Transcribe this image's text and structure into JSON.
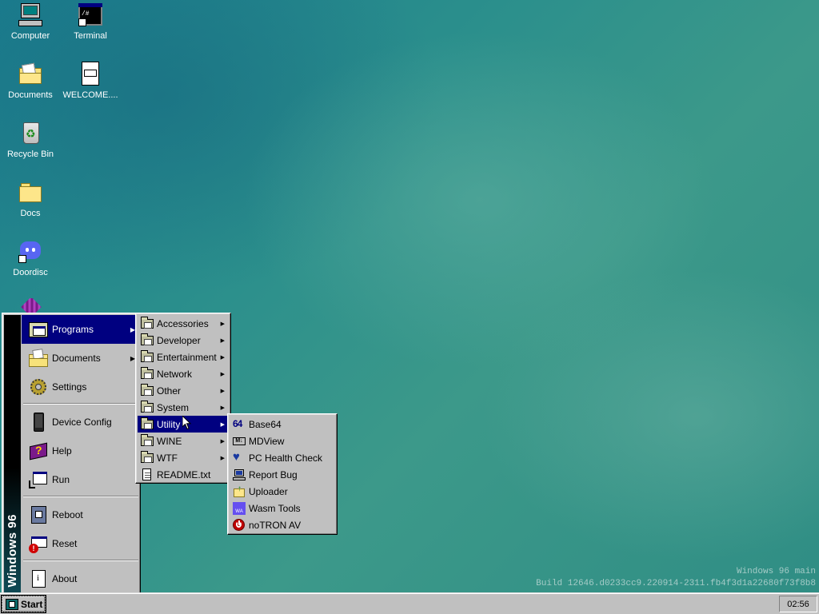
{
  "desktop": {
    "icons": [
      {
        "label": "Computer",
        "icon": "computer-icon"
      },
      {
        "label": "Terminal",
        "icon": "terminal-icon"
      },
      {
        "label": "Documents",
        "icon": "documents-folder-icon"
      },
      {
        "label": "WELCOME....",
        "icon": "markdown-file-icon"
      },
      {
        "label": "Recycle Bin",
        "icon": "recycle-bin-icon"
      },
      {
        "label": "Docs",
        "icon": "folder-icon"
      },
      {
        "label": "Doordisc",
        "icon": "doordisc-icon"
      }
    ],
    "build_line1": "Windows 96 main",
    "build_line2": "Build 12646.d0233cc9.220914-2311.fb4f3d1a22680f73f8b8"
  },
  "start_menu": {
    "banner": "Windows 96",
    "items": [
      {
        "label": "Programs",
        "icon": "programs-icon",
        "submenu": true
      },
      {
        "label": "Documents",
        "icon": "documents-icon",
        "submenu": true
      },
      {
        "label": "Settings",
        "icon": "settings-icon",
        "submenu": false
      },
      {
        "label": "Device Config",
        "icon": "device-config-icon",
        "submenu": false
      },
      {
        "label": "Help",
        "icon": "help-book-icon",
        "submenu": false
      },
      {
        "label": "Run",
        "icon": "run-icon",
        "submenu": false
      },
      {
        "label": "Reboot",
        "icon": "reboot-icon",
        "submenu": false
      },
      {
        "label": "Reset",
        "icon": "reset-icon",
        "submenu": false
      },
      {
        "label": "About",
        "icon": "about-icon",
        "submenu": false
      }
    ]
  },
  "programs_menu": {
    "items": [
      "Accessories",
      "Developer",
      "Entertainment",
      "Network",
      "Other",
      "System",
      "Utility",
      "WINE",
      "WTF",
      "README.txt"
    ]
  },
  "utility_menu": {
    "items": [
      {
        "label": "Base64",
        "icon": "base64-icon"
      },
      {
        "label": "MDView",
        "icon": "mdview-icon"
      },
      {
        "label": "PC Health Check",
        "icon": "heart-icon"
      },
      {
        "label": "Report Bug",
        "icon": "report-bug-icon"
      },
      {
        "label": "Uploader",
        "icon": "uploader-icon"
      },
      {
        "label": "Wasm Tools",
        "icon": "wasm-icon"
      },
      {
        "label": "noTRON AV",
        "icon": "antivirus-icon"
      }
    ]
  },
  "taskbar": {
    "start_label": "Start",
    "clock": "02:56"
  },
  "colors": {
    "menu_highlight": "#000080",
    "menu_face": "#c0c0c0",
    "desktop_teal": "#2b8f8c"
  }
}
